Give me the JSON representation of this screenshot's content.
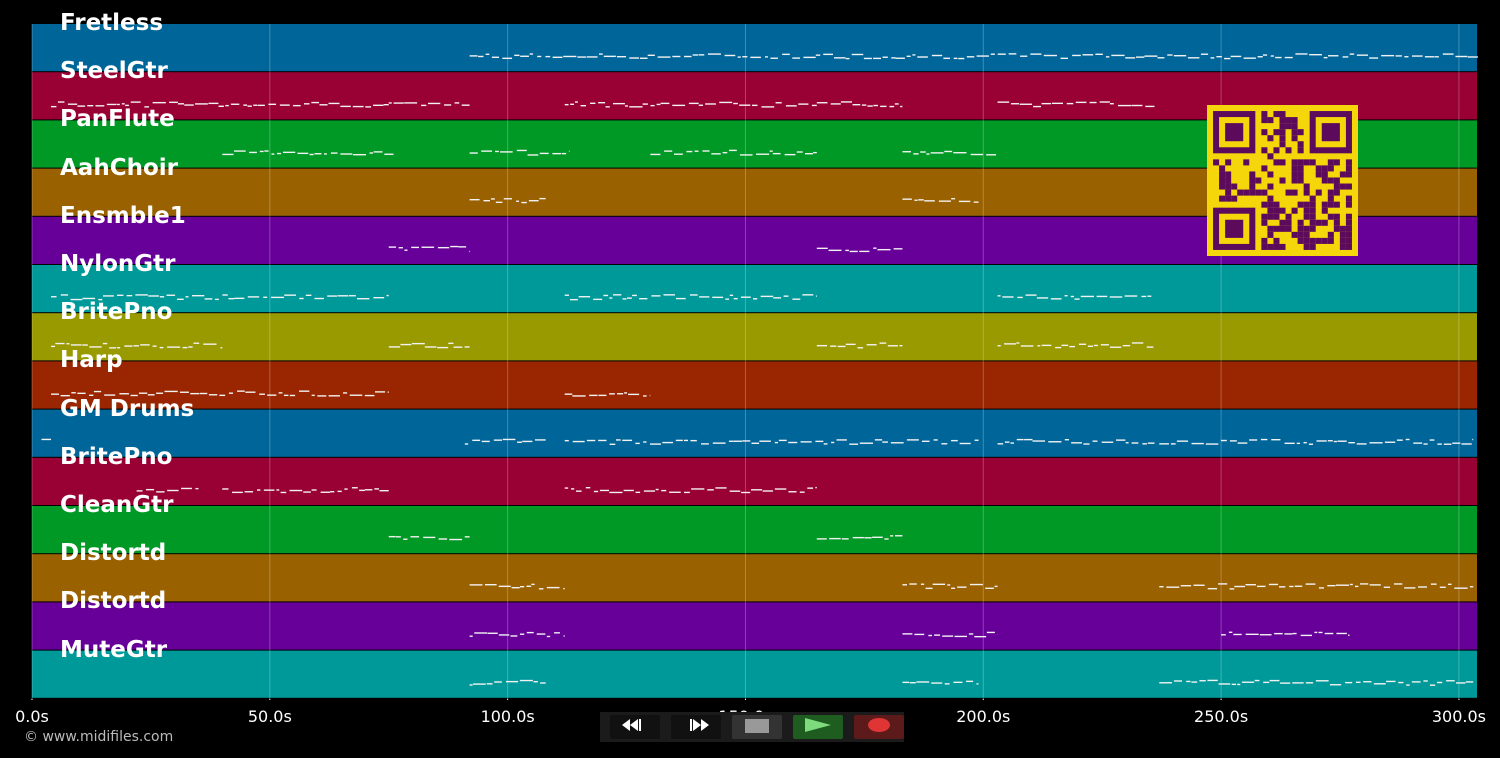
{
  "tracks": [
    {
      "name": "Fretless",
      "color": "#006699"
    },
    {
      "name": "SteelGtr",
      "color": "#990033"
    },
    {
      "name": "PanFlute",
      "color": "#009926"
    },
    {
      "name": "AahChoir",
      "color": "#996100"
    },
    {
      "name": "Ensmble1",
      "color": "#660099"
    },
    {
      "name": "NylonGtr",
      "color": "#009999"
    },
    {
      "name": "BritePno",
      "color": "#999900"
    },
    {
      "name": "Harp",
      "color": "#992600"
    },
    {
      "name": "GM Drums",
      "color": "#006699"
    },
    {
      "name": "BritePno",
      "color": "#990033"
    },
    {
      "name": "CleanGtr",
      "color": "#009926"
    },
    {
      "name": "Distortd",
      "color": "#996100"
    },
    {
      "name": "Distortd",
      "color": "#660099"
    },
    {
      "name": "MuteGtr",
      "color": "#009999"
    }
  ],
  "timeline": {
    "ticks": [
      "0.0s",
      "50.0s",
      "100.0s",
      "150.0s",
      "200.0s",
      "250.0s",
      "300.0s"
    ],
    "tick_values": [
      0,
      50,
      100,
      150,
      200,
      250,
      300
    ],
    "duration_s": 304
  },
  "note_segments": [
    [
      [
        92,
        304
      ]
    ],
    [
      [
        4,
        75
      ],
      [
        75,
        92
      ],
      [
        112,
        165
      ],
      [
        165,
        183
      ],
      [
        203,
        236
      ]
    ],
    [
      [
        40,
        76
      ],
      [
        92,
        113
      ],
      [
        130,
        165
      ],
      [
        183,
        203
      ]
    ],
    [
      [
        92,
        108
      ],
      [
        183,
        199
      ]
    ],
    [
      [
        75,
        92
      ],
      [
        165,
        183
      ]
    ],
    [
      [
        4,
        75
      ],
      [
        112,
        165
      ],
      [
        203,
        236
      ]
    ],
    [
      [
        4,
        40
      ],
      [
        75,
        92
      ],
      [
        165,
        183
      ],
      [
        203,
        236
      ]
    ],
    [
      [
        4,
        75
      ],
      [
        112,
        130
      ]
    ],
    [
      [
        2,
        4
      ],
      [
        91,
        108
      ],
      [
        112,
        199
      ],
      [
        203,
        236
      ],
      [
        237,
        303
      ]
    ],
    [
      [
        22,
        35
      ],
      [
        40,
        75
      ],
      [
        112,
        165
      ]
    ],
    [
      [
        75,
        92
      ],
      [
        165,
        183
      ]
    ],
    [
      [
        92,
        112
      ],
      [
        183,
        203
      ],
      [
        237,
        303
      ]
    ],
    [
      [
        92,
        112
      ],
      [
        183,
        203
      ],
      [
        250,
        277
      ]
    ],
    [
      [
        92,
        108
      ],
      [
        183,
        199
      ],
      [
        237,
        303
      ]
    ]
  ],
  "copyright": "© www.midifiles.com",
  "controls": {
    "rewind": "rewind",
    "fast_forward": "fast-forward",
    "stop": "stop",
    "play": "play",
    "record": "record"
  },
  "colors": {
    "stop_bg": "#333333",
    "play_bg": "#1f5c1f",
    "record_bg": "#5c1a1a",
    "qr_fg": "#5c0a5c",
    "qr_bg": "#f5d60a"
  }
}
